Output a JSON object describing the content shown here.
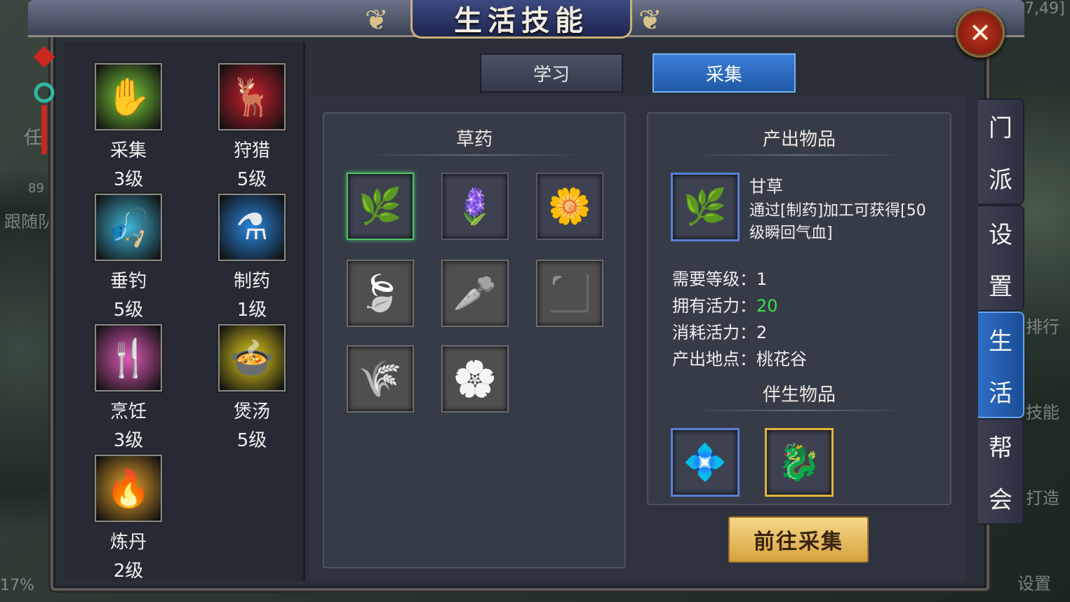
{
  "window": {
    "title": "生活技能",
    "close_icon": "close-icon"
  },
  "background_hud": {
    "coords": "7,49]",
    "left_char_level": "89",
    "left_follow": "跟随队",
    "left_task": "任",
    "right_rank": "排行",
    "right_skill": "技能",
    "right_forge": "打造",
    "right_settings": "设置",
    "percent": "17%"
  },
  "skills": [
    {
      "name": "采集",
      "level": "3级",
      "icon": "gather-icon",
      "color": "#7ed23a"
    },
    {
      "name": "狩猎",
      "level": "5级",
      "icon": "hunt-icon",
      "color": "#d02030"
    },
    {
      "name": "垂钓",
      "level": "5级",
      "icon": "fishing-icon",
      "color": "#3fb6d8"
    },
    {
      "name": "制药",
      "level": "1级",
      "icon": "medicine-icon",
      "color": "#2a86e0"
    },
    {
      "name": "烹饪",
      "level": "3级",
      "icon": "cooking-icon",
      "color": "#e05ab8"
    },
    {
      "name": "煲汤",
      "level": "5级",
      "icon": "soup-icon",
      "color": "#e6d21e"
    },
    {
      "name": "炼丹",
      "level": "2级",
      "icon": "alchemy-icon",
      "color": "#e8a42a"
    }
  ],
  "tabs": [
    {
      "label": "学习",
      "active": false
    },
    {
      "label": "采集",
      "active": true
    }
  ],
  "herb_panel": {
    "title": "草药",
    "items": [
      {
        "icon": "licorice-herb-icon",
        "glyph": "🌿",
        "selected": true,
        "locked": false
      },
      {
        "icon": "purple-flower-herb-icon",
        "glyph": "🪻",
        "selected": false,
        "locked": false
      },
      {
        "icon": "yellow-flower-herb-icon",
        "glyph": "🌼",
        "selected": false,
        "locked": false
      },
      {
        "icon": "leaf-herb-icon",
        "glyph": "🍃",
        "selected": false,
        "locked": true
      },
      {
        "icon": "root-herb-icon",
        "glyph": "🥕",
        "selected": false,
        "locked": true
      },
      {
        "icon": "black-stone-icon",
        "glyph": "⬛",
        "selected": false,
        "locked": true
      },
      {
        "icon": "coral-herb-icon",
        "glyph": "🌾",
        "selected": false,
        "locked": true
      },
      {
        "icon": "peony-herb-icon",
        "glyph": "🌸",
        "selected": false,
        "locked": true
      }
    ]
  },
  "output_panel": {
    "title": "产出物品",
    "item_name": "甘草",
    "item_desc_line1": "通过[制药]加工可获得[50",
    "item_desc_line2": "级瞬回气血]",
    "req_level_label": "需要等级：",
    "req_level_value": "1",
    "own_energy_label": "拥有活力：",
    "own_energy_value": "20",
    "cost_energy_label": "消耗活力：",
    "cost_energy_value": "2",
    "location_label": "产出地点：",
    "location_value": "桃花谷",
    "byproduct_title": "伴生物品",
    "byproducts": [
      {
        "icon": "jade-gem-icon",
        "glyph": "💠",
        "frame": "blue"
      },
      {
        "icon": "dragon-icon",
        "glyph": "🐉",
        "frame": "gold"
      }
    ]
  },
  "go_button": "前往采集",
  "side_tabs": [
    {
      "chars": [
        "门",
        "派"
      ],
      "active": false
    },
    {
      "chars": [
        "设",
        "置"
      ],
      "active": false
    },
    {
      "chars": [
        "生",
        "活"
      ],
      "active": true
    },
    {
      "chars": [
        "帮",
        "会"
      ],
      "active": false
    }
  ]
}
